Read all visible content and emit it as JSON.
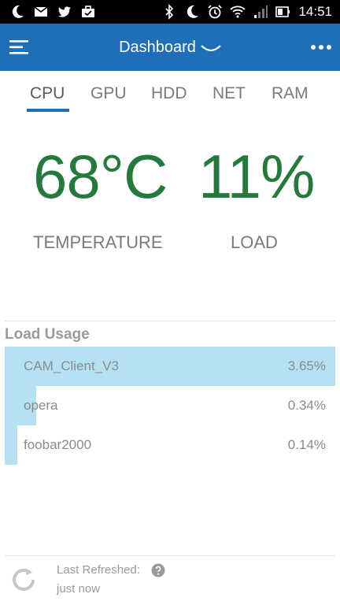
{
  "status_bar": {
    "time": "14:51",
    "left_icons": [
      "moon-icon",
      "mail-icon",
      "twitter-icon",
      "briefcase-icon"
    ],
    "right_icons": [
      "bluetooth-icon",
      "moon-icon",
      "alarm-icon",
      "wifi-icon",
      "signal-icon",
      "battery-icon"
    ]
  },
  "app_bar": {
    "title": "Dashboard",
    "color": "#1e6fb8"
  },
  "tabs": [
    {
      "label": "CPU",
      "active": true
    },
    {
      "label": "GPU",
      "active": false
    },
    {
      "label": "HDD",
      "active": false
    },
    {
      "label": "NET",
      "active": false
    },
    {
      "label": "RAM",
      "active": false
    }
  ],
  "metrics": {
    "temperature": {
      "value": "68°C",
      "label": "TEMPERATURE"
    },
    "load": {
      "value": "11%",
      "label": "LOAD"
    },
    "value_color": "#237a3a"
  },
  "load_usage": {
    "title": "Load Usage",
    "processes": [
      {
        "name": "CAM_Client_V3",
        "percent_text": "3.65%",
        "bar_fraction": 1.0
      },
      {
        "name": "opera",
        "percent_text": "0.34%",
        "bar_fraction": 0.0952
      },
      {
        "name": "foobar2000",
        "percent_text": "0.14%",
        "bar_fraction": 0.0381
      }
    ]
  },
  "footer": {
    "last_refreshed_label": "Last Refreshed:",
    "last_refreshed_value": "just now"
  }
}
